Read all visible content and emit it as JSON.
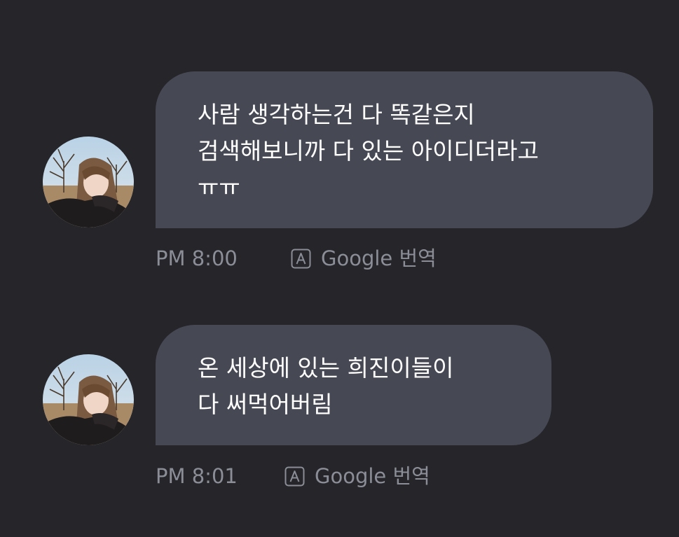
{
  "messages": [
    {
      "lines": [
        "사람 생각하는건 다 똑같은지",
        "검색해보니까 다 있는 아이디더라고",
        "ㅠㅠ"
      ],
      "time": "PM 8:00",
      "translate_label": "Google 번역"
    },
    {
      "lines": [
        "온 세상에 있는 희진이들이",
        "다 써먹어버림"
      ],
      "time": "PM 8:01",
      "translate_label": "Google 번역"
    }
  ],
  "colors": {
    "background": "#25252a",
    "bubble": "#464854",
    "meta_text": "#8b8d97"
  }
}
